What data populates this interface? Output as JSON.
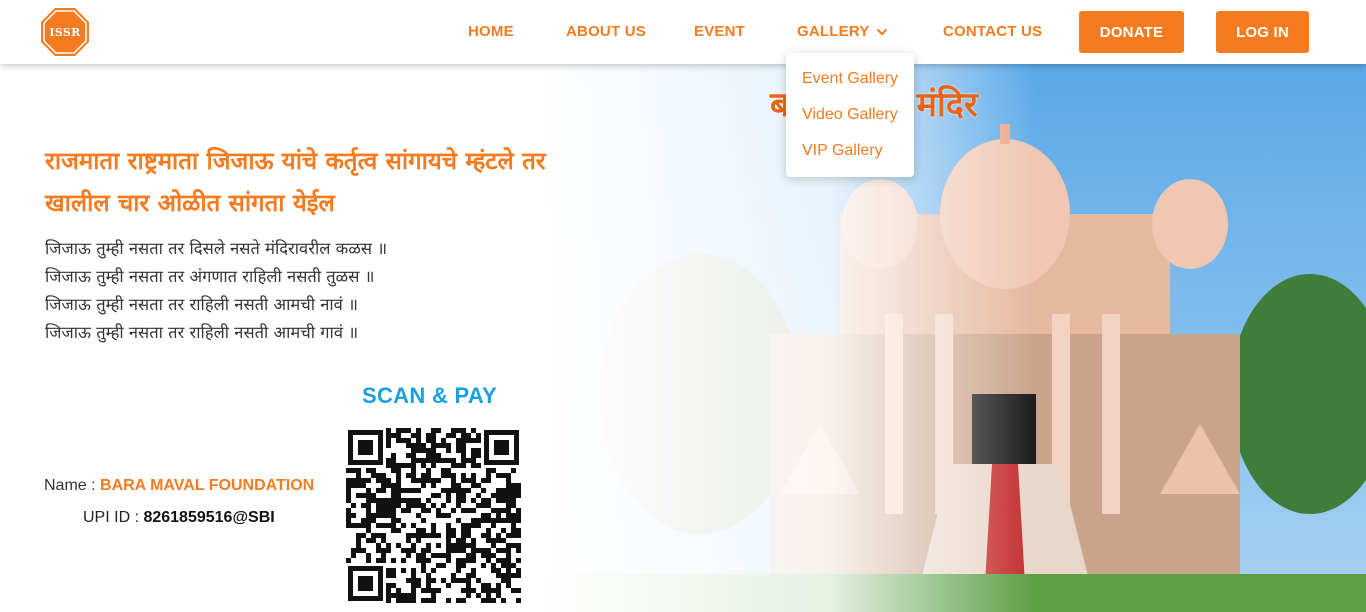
{
  "brand": {
    "logo_text": "ISSR",
    "accent_color": "#f47b20"
  },
  "nav": {
    "home": "HOME",
    "about": "ABOUT US",
    "event": "EVENT",
    "gallery": "GALLERY",
    "contact": "CONTACT US",
    "donate": "DONATE",
    "login": "LOG IN"
  },
  "gallery_menu": {
    "items": [
      "Event Gallery",
      "Video Gallery",
      "VIP Gallery"
    ]
  },
  "hero": {
    "temple_title": "बा जिजाऊ मंदिर",
    "headline": "राजमाता राष्ट्रमाता जिजाऊ यांचे कर्तृत्व सांगायचे म्हंटले तर खालील चार ओळीत सांगता येईल",
    "poem": [
      "जिजाऊ तुम्ही नसता तर दिसले नसते मंदिरावरील कळस ॥",
      "जिजाऊ तुम्ही नसता तर अंगणात राहिली नसती तुळस ॥",
      "जिजाऊ तुम्ही नसता तर राहिली नसती आमची नावं ॥",
      "जिजाऊ तुम्ही नसता तर राहिली नसती आमची गावं ॥"
    ]
  },
  "payment": {
    "scan_pay": "SCAN & PAY",
    "name_label": "Name : ",
    "name_value": "BARA MAVAL FOUNDATION",
    "upi_label": "UPI ID : ",
    "upi_value": "8261859516@SBI"
  }
}
